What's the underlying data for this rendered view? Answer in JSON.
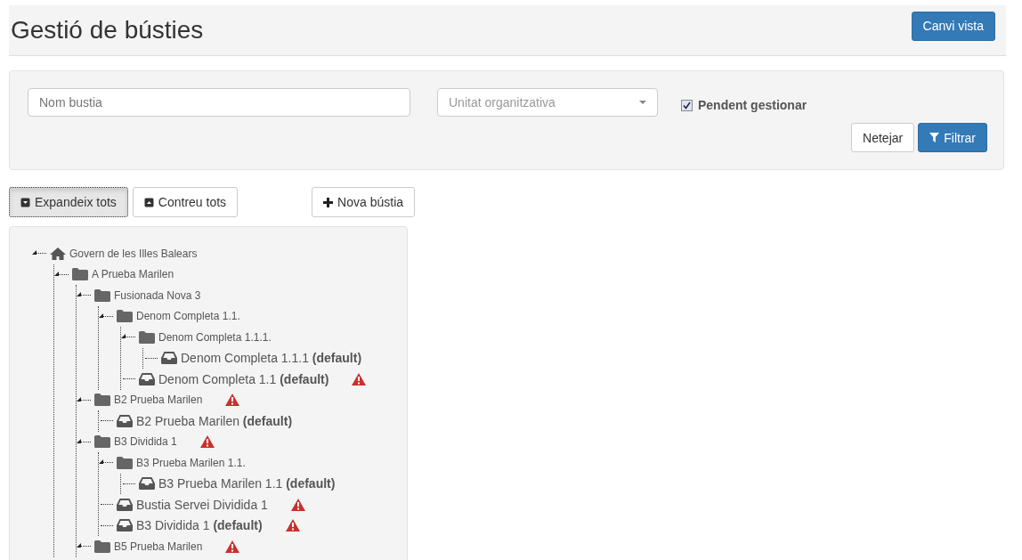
{
  "header": {
    "title": "Gestió de bústies",
    "view_button": "Canvi vista"
  },
  "filters": {
    "name_field": {
      "placeholder": "Nom bustia"
    },
    "unit_select": {
      "placeholder": "Unitat organitzativa"
    },
    "pending": {
      "label": "Pendent gestionar",
      "checked": true
    },
    "clear_button": "Netejar",
    "filter_button": "Filtrar"
  },
  "toolbar": {
    "expand_all": "Expandeix tots",
    "collapse_all": "Contreu tots",
    "new_mailbox": "Nova bústia"
  },
  "tree": [
    {
      "kind": "home",
      "label": "Govern de les Illes Balears",
      "expanded": true,
      "warning": false,
      "children": [
        {
          "kind": "folder",
          "label": "A Prueba Marilen",
          "expanded": true,
          "warning": false,
          "children": [
            {
              "kind": "folder",
              "label": "Fusionada Nova 3",
              "expanded": true,
              "warning": false,
              "children": [
                {
                  "kind": "folder",
                  "label": "Denom Completa 1.1.",
                  "expanded": true,
                  "warning": false,
                  "children": [
                    {
                      "kind": "folder",
                      "label": "Denom Completa 1.1.1.",
                      "expanded": true,
                      "warning": false,
                      "children": [
                        {
                          "kind": "mailbox",
                          "label": "Denom Completa 1.1.1 **(default)**",
                          "warning": false
                        }
                      ]
                    },
                    {
                      "kind": "mailbox",
                      "label": "Denom Completa 1.1 **(default)**",
                      "warning": true
                    }
                  ]
                }
              ]
            },
            {
              "kind": "folder",
              "label": "B2 Prueba Marilen",
              "expanded": true,
              "warning": true,
              "children": [
                {
                  "kind": "mailbox",
                  "label": "B2 Prueba Marilen **(default)**",
                  "warning": false
                }
              ]
            },
            {
              "kind": "folder",
              "label": "B3 Dividida 1",
              "expanded": true,
              "warning": true,
              "children": [
                {
                  "kind": "folder",
                  "label": "B3 Prueba Marilen 1.1.",
                  "expanded": true,
                  "warning": false,
                  "children": [
                    {
                      "kind": "mailbox",
                      "label": "B3 Prueba Marilen 1.1 **(default)**",
                      "warning": false
                    }
                  ]
                },
                {
                  "kind": "mailbox",
                  "label": "Bustia Servei Dividida 1",
                  "warning": true
                },
                {
                  "kind": "mailbox",
                  "label": "B3 Dividida 1 **(default)**",
                  "warning": true
                }
              ]
            },
            {
              "kind": "folder",
              "label": "B5 Prueba Marilen",
              "expanded": true,
              "warning": true
            }
          ]
        }
      ]
    }
  ]
}
